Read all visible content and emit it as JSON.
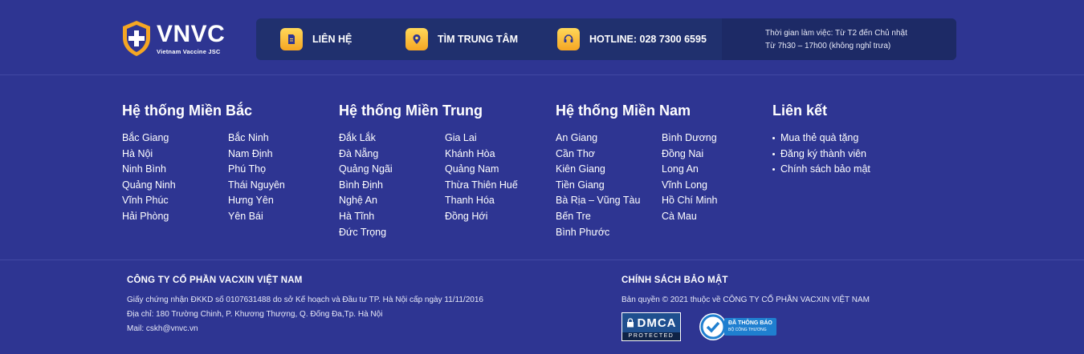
{
  "brand": {
    "name": "VNVC",
    "tagline": "Vietnam Vaccine JSC"
  },
  "topbar": {
    "contact_label": "LIÊN HỆ",
    "find_center_label": "TÌM TRUNG TÂM",
    "hotline_label": "HOTLINE: 028 7300 6595",
    "hours_line1": "Thời gian làm việc: Từ T2 đến Chủ nhật",
    "hours_line2": "Từ 7h30 – 17h00 (không nghỉ trưa)"
  },
  "regions": {
    "north": {
      "title": "Hệ thống Miền Bắc",
      "col1": [
        "Bắc Giang",
        "Hà Nội",
        "Ninh Bình",
        "Quảng Ninh",
        "Vĩnh Phúc",
        "Hải Phòng"
      ],
      "col2": [
        "Bắc Ninh",
        "Nam Định",
        "Phú Thọ",
        "Thái Nguyên",
        "Hưng Yên",
        "Yên Bái"
      ]
    },
    "central": {
      "title": "Hệ thống Miền Trung",
      "col1": [
        "Đắk Lắk",
        "Đà Nẵng",
        "Quảng Ngãi",
        "Bình Định",
        "Nghệ An",
        "Hà Tĩnh",
        "Đức Trọng"
      ],
      "col2": [
        "Gia Lai",
        "Khánh Hòa",
        "Quảng Nam",
        "Thừa Thiên Huế",
        "Thanh Hóa",
        "Đồng Hới"
      ]
    },
    "south": {
      "title": "Hệ thống Miền Nam",
      "col1": [
        "An Giang",
        "Cần Thơ",
        "Kiên Giang",
        "Tiền Giang",
        "Bà Rịa – Vũng Tàu",
        "Bến Tre",
        "Bình Phước"
      ],
      "col2": [
        "Bình Dương",
        "Đồng Nai",
        "Long An",
        "Vĩnh Long",
        "Hồ Chí Minh",
        "Cà Mau"
      ]
    },
    "links": {
      "title": "Liên kết",
      "items": [
        "Mua thẻ quà tặng",
        "Đăng ký thành viên",
        "Chính sách bảo mật"
      ]
    }
  },
  "company": {
    "title": "CÔNG TY CỔ PHẦN VACXIN VIỆT NAM",
    "license": "Giấy chứng nhận ĐKKD số 0107631488 do sở Kế hoạch và Đầu tư TP. Hà Nội cấp ngày 11/11/2016",
    "address": "Địa chỉ: 180 Trường Chinh, P. Khương Thượng, Q. Đống Đa,Tp. Hà Nội",
    "email": "Mail: cskh@vnvc.vn"
  },
  "policy": {
    "title": "CHÍNH SÁCH BẢO MẬT",
    "copyright": "Bản quyền © 2021 thuộc về CÔNG TY CỔ PHẦN VACXIN VIỆT NAM",
    "dmca_top": "DMCA",
    "dmca_bottom": "PROTECTED",
    "bct_line1": "ĐÃ THÔNG BÁO",
    "bct_line2": "BỘ CÔNG THƯƠNG"
  },
  "colors": {
    "background": "#2e3592",
    "panel": "#20306e",
    "accent": "#f5a623"
  },
  "icons": [
    "shield-logo-icon",
    "document-icon",
    "location-pin-icon",
    "headset-icon",
    "lock-icon",
    "checkmark-icon"
  ]
}
